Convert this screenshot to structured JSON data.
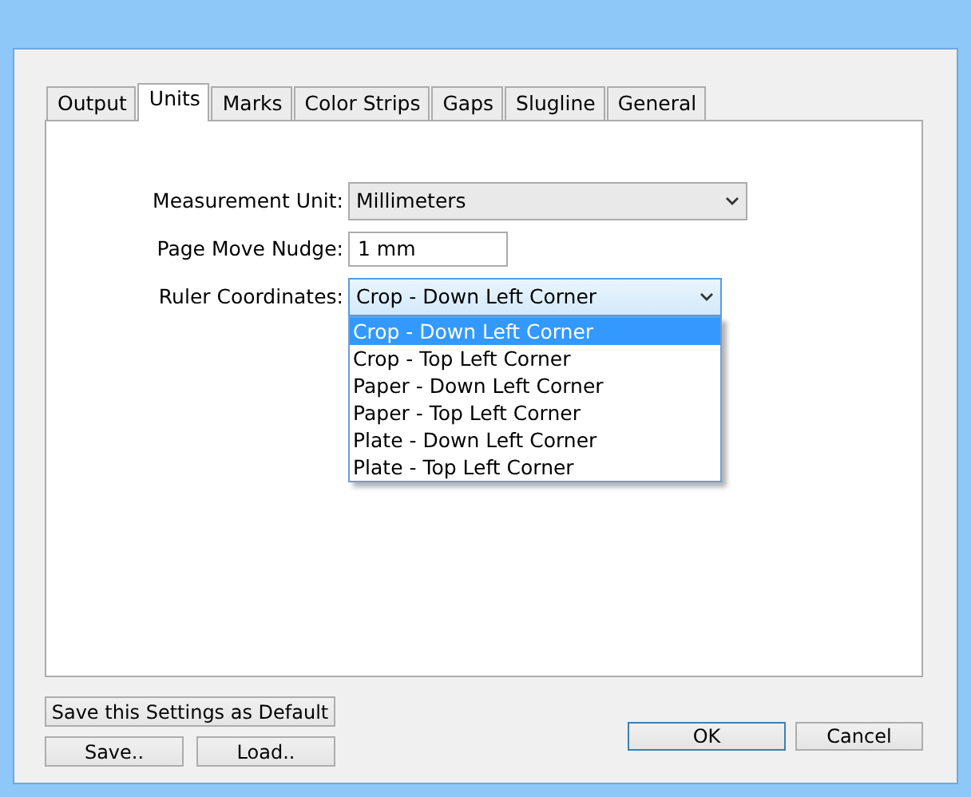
{
  "tabs": [
    {
      "label": "Output",
      "selected": false
    },
    {
      "label": "Units",
      "selected": true
    },
    {
      "label": "Marks",
      "selected": false
    },
    {
      "label": "Color Strips",
      "selected": false
    },
    {
      "label": "Gaps",
      "selected": false
    },
    {
      "label": "Slugline",
      "selected": false
    },
    {
      "label": "General",
      "selected": false
    }
  ],
  "fields": [
    {
      "kind": "select",
      "label": "Measurement Unit:",
      "value": "Millimeters",
      "expanded": false
    },
    {
      "kind": "input",
      "label": "Page Move Nudge:",
      "value": "1 mm"
    },
    {
      "kind": "select",
      "label": "Ruler Coordinates:",
      "value": "Crop - Down Left Corner",
      "expanded": true,
      "options": [
        {
          "label": "Crop - Down Left Corner",
          "selected": true
        },
        {
          "label": "Crop - Top Left Corner",
          "selected": false
        },
        {
          "label": "Paper - Down Left Corner",
          "selected": false
        },
        {
          "label": "Paper - Top Left Corner",
          "selected": false
        },
        {
          "label": "Plate - Down Left Corner",
          "selected": false
        },
        {
          "label": "Plate - Top Left Corner",
          "selected": false
        }
      ]
    }
  ],
  "buttons": {
    "save_default": "Save this Settings as Default",
    "save": "Save..",
    "load": "Load..",
    "ok": "OK",
    "cancel": "Cancel"
  }
}
